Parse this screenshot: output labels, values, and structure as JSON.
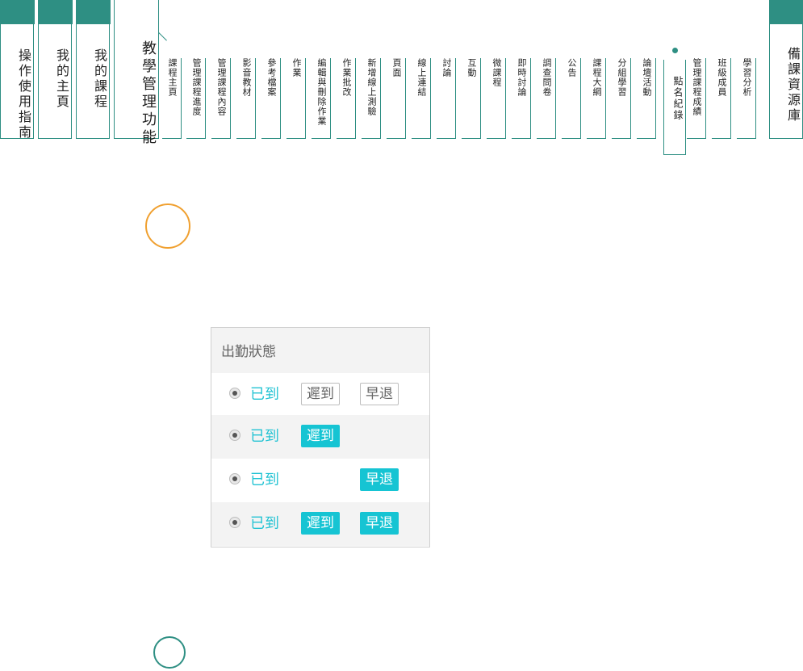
{
  "nav": {
    "main_tabs": [
      "操作使用指南",
      "我的主頁",
      "我的課程"
    ],
    "teach_tab": "教學管理功能",
    "sub_tabs": [
      "課程主頁",
      "管理課程進度",
      "管理課程內容",
      "影音教材",
      "參考檔案",
      "作業",
      "編輯與刪除作業",
      "作業批改",
      "新增線上測驗",
      "頁面",
      "線上連結",
      "討論",
      "互動",
      "微課程",
      "即時討論",
      "調查問卷",
      "公告",
      "課程大綱",
      "分組學習",
      "論壇活動"
    ],
    "active_tab": "點名紀錄",
    "after_tabs": [
      "管理課程成績",
      "班級成員",
      "學習分析"
    ],
    "right_tab": "備課資源庫"
  },
  "attendance": {
    "header": "出勤狀態",
    "rows": [
      {
        "present": "已到",
        "late": "遲到",
        "early": "早退",
        "late_on": false,
        "early_on": false
      },
      {
        "present": "已到",
        "late": "遲到",
        "late_on": true
      },
      {
        "present": "已到",
        "early": "早退",
        "early_on": true
      },
      {
        "present": "已到",
        "late": "遲到",
        "early": "早退",
        "late_on": true,
        "early_on": true
      }
    ]
  },
  "colors": {
    "nav_teal": "#2e8f83",
    "accent_cyan": "#16c4d3",
    "orange": "#f0a030"
  }
}
